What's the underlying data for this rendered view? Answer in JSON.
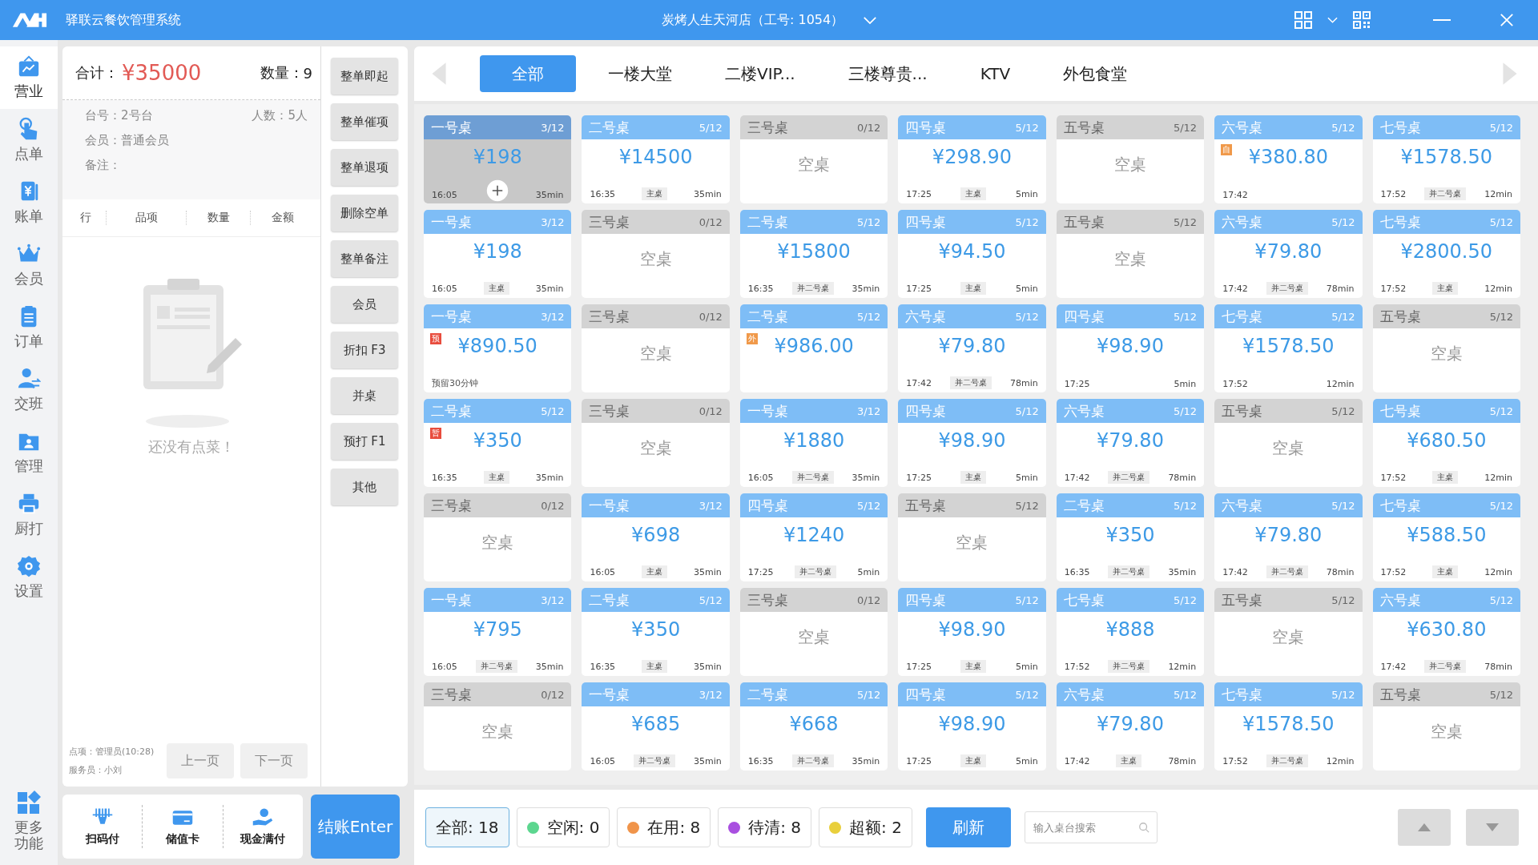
{
  "window": {
    "title": "驿联云餐饮管理系统",
    "store": "炭烤人生天河店（工号: 1054）"
  },
  "sidebar": {
    "items": [
      {
        "label": "营业",
        "selected": true
      },
      {
        "label": "点单",
        "selected": false
      },
      {
        "label": "账单",
        "selected": false
      },
      {
        "label": "会员",
        "selected": false
      },
      {
        "label": "订单",
        "selected": false
      },
      {
        "label": "交班",
        "selected": false
      },
      {
        "label": "管理",
        "selected": false
      },
      {
        "label": "厨打",
        "selected": false
      },
      {
        "label": "设置",
        "selected": false
      }
    ],
    "more": "更多功能"
  },
  "order": {
    "total_label": "合计：",
    "total": "¥35000",
    "quantity_label": "数量：",
    "quantity": "9",
    "table_no": "台号：2号台",
    "guests": "人数：5人",
    "member": "会员：普通会员",
    "note": "备注：",
    "columns": [
      "行",
      "品项",
      "数量",
      "金额"
    ],
    "empty_message": "还没有点菜！",
    "ordered_by": "点项：管理员(10:28)",
    "waiter": "服务员：小刘",
    "pager": [
      {
        "label": "上一页",
        "disabled": true
      },
      {
        "label": "下一页",
        "disabled": true
      }
    ]
  },
  "actions": [
    "整单即起",
    "整单催项",
    "整单退项",
    "删除空单",
    "整单备注",
    "会员",
    "折扣 F3",
    "并桌",
    "预打 F1",
    "其他"
  ],
  "payment": {
    "methods": [
      "扫码付",
      "储值卡",
      "现金满付"
    ],
    "checkout": "结账Enter"
  },
  "tabs": [
    {
      "label": "全部",
      "selected": true
    },
    {
      "label": "一楼大堂",
      "selected": false
    },
    {
      "label": "二楼VIP...",
      "selected": false
    },
    {
      "label": "三楼尊贵...",
      "selected": false
    },
    {
      "label": "KTV",
      "selected": false
    },
    {
      "label": "外包食堂",
      "selected": false
    }
  ],
  "tables": [
    {
      "name": "一号桌",
      "count": "3/12",
      "kind": "occupied",
      "selected": true,
      "amount": "¥198",
      "time": "16:05",
      "duration": "35min"
    },
    {
      "name": "二号桌",
      "count": "5/12",
      "kind": "occupied",
      "selected": false,
      "amount": "¥14500",
      "time": "16:35",
      "tag": "主桌",
      "duration": "35min"
    },
    {
      "name": "三号桌",
      "count": "0/12",
      "kind": "empty",
      "selected": false,
      "status": "空桌"
    },
    {
      "name": "四号桌",
      "count": "5/12",
      "kind": "occupied",
      "selected": false,
      "amount": "¥298.90",
      "time": "17:25",
      "tag": "主桌",
      "duration": "5min"
    },
    {
      "name": "五号桌",
      "count": "5/12",
      "kind": "empty",
      "selected": false,
      "status": "空桌"
    },
    {
      "name": "六号桌",
      "count": "5/12",
      "kind": "occupied",
      "selected": false,
      "amount": "¥380.80",
      "time": "17:42",
      "badge": {
        "text": "自",
        "color": "#f0994a"
      }
    },
    {
      "name": "七号桌",
      "count": "5/12",
      "kind": "occupied",
      "selected": false,
      "amount": "¥1578.50",
      "time": "17:52",
      "tag": "并二号桌",
      "duration": "12min"
    },
    {
      "name": "一号桌",
      "count": "3/12",
      "kind": "occupied",
      "selected": false,
      "amount": "¥198",
      "time": "16:05",
      "tag": "主桌",
      "duration": "35min"
    },
    {
      "name": "三号桌",
      "count": "0/12",
      "kind": "empty",
      "selected": false,
      "status": "空桌"
    },
    {
      "name": "二号桌",
      "count": "5/12",
      "kind": "occupied",
      "selected": false,
      "amount": "¥15800",
      "time": "16:35",
      "tag": "并二号桌",
      "duration": "35min"
    },
    {
      "name": "四号桌",
      "count": "5/12",
      "kind": "occupied",
      "selected": false,
      "amount": "¥94.50",
      "time": "17:25",
      "tag": "主桌",
      "duration": "5min"
    },
    {
      "name": "五号桌",
      "count": "5/12",
      "kind": "empty",
      "selected": false,
      "status": "空桌"
    },
    {
      "name": "六号桌",
      "count": "5/12",
      "kind": "occupied",
      "selected": false,
      "amount": "¥79.80",
      "time": "17:42",
      "tag": "并二号桌",
      "duration": "78min"
    },
    {
      "name": "七号桌",
      "count": "5/12",
      "kind": "occupied",
      "selected": false,
      "amount": "¥2800.50",
      "time": "17:52",
      "tag": "主桌",
      "duration": "12min"
    },
    {
      "name": "一号桌",
      "count": "3/12",
      "kind": "occupied",
      "selected": false,
      "amount": "¥890.50",
      "badge": {
        "text": "预",
        "color": "#e84c3d"
      },
      "note": "预留30分钟"
    },
    {
      "name": "三号桌",
      "count": "0/12",
      "kind": "empty",
      "selected": false,
      "status": "空桌"
    },
    {
      "name": "二号桌",
      "count": "5/12",
      "kind": "occupied",
      "selected": false,
      "amount": "¥986.00",
      "badge": {
        "text": "外",
        "color": "#f0994a"
      }
    },
    {
      "name": "六号桌",
      "count": "5/12",
      "kind": "occupied",
      "selected": false,
      "amount": "¥79.80",
      "time": "17:42",
      "tag": "并二号桌",
      "duration": "78min"
    },
    {
      "name": "四号桌",
      "count": "5/12",
      "kind": "occupied",
      "selected": false,
      "amount": "¥98.90",
      "time": "17:25",
      "duration": "5min"
    },
    {
      "name": "七号桌",
      "count": "5/12",
      "kind": "occupied",
      "selected": false,
      "amount": "¥1578.50",
      "time": "17:52",
      "duration": "12min"
    },
    {
      "name": "五号桌",
      "count": "5/12",
      "kind": "empty",
      "selected": false,
      "status": "空桌"
    },
    {
      "name": "二号桌",
      "count": "5/12",
      "kind": "occupied",
      "selected": false,
      "amount": "¥350",
      "time": "16:35",
      "tag": "主桌",
      "duration": "35min",
      "badge": {
        "text": "暂",
        "color": "#e84c3d"
      }
    },
    {
      "name": "三号桌",
      "count": "0/12",
      "kind": "empty",
      "selected": false,
      "status": "空桌"
    },
    {
      "name": "一号桌",
      "count": "3/12",
      "kind": "occupied",
      "selected": false,
      "amount": "¥1880",
      "time": "16:05",
      "tag": "并二号桌",
      "duration": "35min"
    },
    {
      "name": "四号桌",
      "count": "5/12",
      "kind": "occupied",
      "selected": false,
      "amount": "¥98.90",
      "time": "17:25",
      "tag": "主桌",
      "duration": "5min"
    },
    {
      "name": "六号桌",
      "count": "5/12",
      "kind": "occupied",
      "selected": false,
      "amount": "¥79.80",
      "time": "17:42",
      "tag": "并二号桌",
      "duration": "78min"
    },
    {
      "name": "五号桌",
      "count": "5/12",
      "kind": "empty",
      "selected": false,
      "status": "空桌"
    },
    {
      "name": "七号桌",
      "count": "5/12",
      "kind": "occupied",
      "selected": false,
      "amount": "¥680.50",
      "time": "17:52",
      "tag": "主桌",
      "duration": "12min"
    },
    {
      "name": "三号桌",
      "count": "0/12",
      "kind": "empty",
      "selected": false,
      "status": "空桌"
    },
    {
      "name": "一号桌",
      "count": "3/12",
      "kind": "occupied",
      "selected": false,
      "amount": "¥698",
      "time": "16:05",
      "tag": "主桌",
      "duration": "35min"
    },
    {
      "name": "四号桌",
      "count": "5/12",
      "kind": "occupied",
      "selected": false,
      "amount": "¥1240",
      "time": "17:25",
      "tag": "并二号桌",
      "duration": "5min"
    },
    {
      "name": "五号桌",
      "count": "5/12",
      "kind": "empty",
      "selected": false,
      "status": "空桌"
    },
    {
      "name": "二号桌",
      "count": "5/12",
      "kind": "occupied",
      "selected": false,
      "amount": "¥350",
      "time": "16:35",
      "tag": "并二号桌",
      "duration": "35min"
    },
    {
      "name": "六号桌",
      "count": "5/12",
      "kind": "occupied",
      "selected": false,
      "amount": "¥79.80",
      "time": "17:42",
      "tag": "并二号桌",
      "duration": "78min"
    },
    {
      "name": "七号桌",
      "count": "5/12",
      "kind": "occupied",
      "selected": false,
      "amount": "¥588.50",
      "time": "17:52",
      "tag": "主桌",
      "duration": "12min"
    },
    {
      "name": "一号桌",
      "count": "3/12",
      "kind": "occupied",
      "selected": false,
      "amount": "¥795",
      "time": "16:05",
      "tag": "并二号桌",
      "duration": "35min"
    },
    {
      "name": "二号桌",
      "count": "5/12",
      "kind": "occupied",
      "selected": false,
      "amount": "¥350",
      "time": "16:35",
      "tag": "主桌",
      "duration": "35min"
    },
    {
      "name": "三号桌",
      "count": "0/12",
      "kind": "empty",
      "selected": false,
      "status": "空桌"
    },
    {
      "name": "四号桌",
      "count": "5/12",
      "kind": "occupied",
      "selected": false,
      "amount": "¥98.90",
      "time": "17:25",
      "tag": "主桌",
      "duration": "5min"
    },
    {
      "name": "七号桌",
      "count": "5/12",
      "kind": "occupied",
      "selected": false,
      "amount": "¥888",
      "time": "17:52",
      "tag": "并二号桌",
      "duration": "12min"
    },
    {
      "name": "五号桌",
      "count": "5/12",
      "kind": "empty",
      "selected": false,
      "status": "空桌"
    },
    {
      "name": "六号桌",
      "count": "5/12",
      "kind": "occupied",
      "selected": false,
      "amount": "¥630.80",
      "time": "17:42",
      "tag": "并二号桌",
      "duration": "78min"
    },
    {
      "name": "三号桌",
      "count": "0/12",
      "kind": "empty",
      "selected": false,
      "status": "空桌"
    },
    {
      "name": "一号桌",
      "count": "3/12",
      "kind": "occupied",
      "selected": false,
      "amount": "¥685",
      "time": "16:05",
      "tag": "并二号桌",
      "duration": "35min"
    },
    {
      "name": "二号桌",
      "count": "5/12",
      "kind": "occupied",
      "selected": false,
      "amount": "¥668",
      "time": "16:35",
      "tag": "并二号桌",
      "duration": "35min"
    },
    {
      "name": "四号桌",
      "count": "5/12",
      "kind": "occupied",
      "selected": false,
      "amount": "¥98.90",
      "time": "17:25",
      "tag": "主桌",
      "duration": "5min"
    },
    {
      "name": "六号桌",
      "count": "5/12",
      "kind": "occupied",
      "selected": false,
      "amount": "¥79.80",
      "time": "17:42",
      "tag": "主桌",
      "duration": "78min"
    },
    {
      "name": "七号桌",
      "count": "5/12",
      "kind": "occupied",
      "selected": false,
      "amount": "¥1578.50",
      "time": "17:52",
      "tag": "并二号桌",
      "duration": "12min"
    },
    {
      "name": "五号桌",
      "count": "5/12",
      "kind": "empty",
      "selected": false,
      "status": "空桌"
    }
  ],
  "filters": [
    {
      "label": "全部: 18",
      "selected": true
    },
    {
      "label": "空闲: 0",
      "selected": false,
      "color": "#5cd68f"
    },
    {
      "label": "在用: 8",
      "selected": false,
      "color": "#f0944a"
    },
    {
      "label": "待清: 8",
      "selected": false,
      "color": "#a94fe0"
    },
    {
      "label": "超额: 2",
      "selected": false,
      "color": "#e9cf3c"
    }
  ],
  "refresh": "刷新",
  "search": {
    "placeholder": "输入桌台搜索"
  }
}
